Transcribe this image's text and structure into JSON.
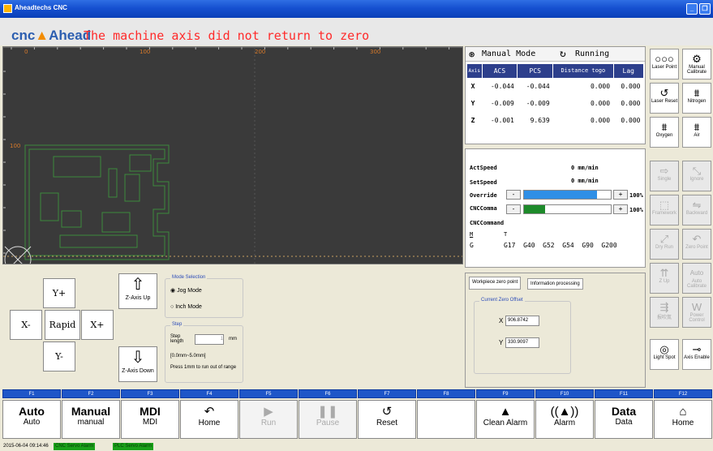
{
  "window": {
    "title": "Aheadtechs CNC"
  },
  "header": {
    "logo_main": "cnc",
    "logo_accent": "Ahead",
    "alarm_text": "The machine axis did not return to zero"
  },
  "canvas": {
    "ruler_labels": [
      "0",
      "100",
      "200",
      "300"
    ],
    "v_labels": [
      "100"
    ]
  },
  "status": {
    "mode_label": "Manual Mode",
    "run_label": "Running",
    "columns": [
      "Axis",
      "ACS",
      "PCS",
      "Distance togo",
      "Lag"
    ],
    "rows": [
      {
        "axis": "X",
        "acs": "-0.044",
        "pcs": "-0.044",
        "togo": "0.000",
        "lag": "0.000"
      },
      {
        "axis": "Y",
        "acs": "-0.009",
        "pcs": "-0.009",
        "togo": "0.000",
        "lag": "0.000"
      },
      {
        "axis": "Z",
        "acs": "-0.001",
        "pcs": "9.639",
        "togo": "0.000",
        "lag": "0.000"
      }
    ]
  },
  "speed": {
    "act_label": "ActSpeed",
    "act_value": "0 mm/min",
    "set_label": "SetSpeed",
    "set_value": "0 mm/min",
    "override_label": "Override",
    "override_pct": "100%",
    "override_level": 0.84,
    "cnccomma_label": "CNCComma",
    "cnccomma_pct": "100%",
    "cnccomma_level": 0.24,
    "command_label": "CNCCommand",
    "m_label": "M",
    "t_label": "T",
    "g_label": "G",
    "g_codes": "G17  G40  G52  G54  G90  G200"
  },
  "jog": {
    "y_plus": "Y+",
    "y_minus": "Y-",
    "x_minus": "X-",
    "x_plus": "X+",
    "rapid": "Rapid",
    "z_up": "Z-Axis Up",
    "z_down": "Z-Axis Down",
    "mode_title": "Mode Selection",
    "jog_mode": "Jog Mode",
    "inch_mode": "Inch Mode",
    "step_title": "Step",
    "step_length": "Step length",
    "step_value": "1",
    "step_unit": "mm",
    "step_range": "[0.0mm~5.0mm]",
    "step_hint": "Press 1mm to run out of range"
  },
  "workpiece": {
    "tab1": "Workpiece zero point",
    "tab2": "Information processing",
    "offset_title": "Current Zero Offset",
    "x_label": "X",
    "x_value": "906.8742",
    "y_label": "Y",
    "y_value": "330.9097"
  },
  "tools": [
    {
      "label": "Laser Point",
      "icon": "dots-icon",
      "glyph": "○○○",
      "disabled": false
    },
    {
      "label": "Manual Calibrate",
      "icon": "calibrate-icon",
      "glyph": "⚙",
      "disabled": false
    },
    {
      "label": "Laser Reset",
      "icon": "reset-icon",
      "glyph": "↺",
      "disabled": false
    },
    {
      "label": "Nitrogen",
      "icon": "gas-valve-icon",
      "glyph": "⩩",
      "disabled": false
    },
    {
      "label": "Oxygen",
      "icon": "gas-valve-icon",
      "glyph": "⩩",
      "disabled": false
    },
    {
      "label": "Air",
      "icon": "gas-valve-icon",
      "glyph": "⩩",
      "disabled": false
    },
    {
      "label": "Single",
      "icon": "arrow-right-icon",
      "glyph": "⇨",
      "disabled": true
    },
    {
      "label": "Ignore",
      "icon": "ignore-icon",
      "glyph": "⤡",
      "disabled": true
    },
    {
      "label": "Framework",
      "icon": "frame-icon",
      "glyph": "⬚",
      "disabled": true
    },
    {
      "label": "Backward",
      "icon": "backward-icon",
      "glyph": "⇋",
      "disabled": true
    },
    {
      "label": "Dry Run",
      "icon": "dry-run-icon",
      "glyph": "⤢",
      "disabled": true
    },
    {
      "label": "Zero Point",
      "icon": "zero-point-icon",
      "glyph": "↶",
      "disabled": true
    },
    {
      "label": "Z Up",
      "icon": "z-up-icon",
      "glyph": "⇈",
      "disabled": true
    },
    {
      "label": "Auto Calibrate",
      "icon": "auto-calibrate-icon",
      "glyph": "Auto",
      "disabled": true
    },
    {
      "label": "报吹氮",
      "icon": "blow-icon",
      "glyph": "⇶",
      "disabled": true
    },
    {
      "label": "Power Control",
      "icon": "power-control-icon",
      "glyph": "W",
      "disabled": true
    },
    {
      "label": "Light Spot",
      "icon": "light-spot-icon",
      "glyph": "◎",
      "disabled": false
    },
    {
      "label": "Axis Enable",
      "icon": "axis-enable-icon",
      "glyph": "⊸",
      "disabled": false
    }
  ],
  "fkeys": [
    {
      "key": "F1",
      "main": "Auto",
      "sub": "Auto",
      "type": "text",
      "disabled": false
    },
    {
      "key": "F2",
      "main": "Manual",
      "sub": "manual",
      "type": "text",
      "disabled": false
    },
    {
      "key": "F3",
      "main": "MDI",
      "sub": "MDI",
      "type": "text",
      "disabled": false
    },
    {
      "key": "F4",
      "main": "↶",
      "sub": "Home",
      "type": "icon",
      "icon": "return-icon",
      "disabled": false
    },
    {
      "key": "F5",
      "main": "▶",
      "sub": "Run",
      "type": "icon",
      "icon": "play-icon",
      "disabled": true
    },
    {
      "key": "F6",
      "main": "❚❚",
      "sub": "Pause",
      "type": "icon",
      "icon": "pause-icon",
      "disabled": true
    },
    {
      "key": "F7",
      "main": "↺",
      "sub": "Reset",
      "type": "icon",
      "icon": "reset-icon",
      "disabled": false
    },
    {
      "key": "F8",
      "main": "",
      "sub": "",
      "type": "icon",
      "icon": "empty-icon",
      "disabled": false
    },
    {
      "key": "F9",
      "main": "▲",
      "sub": "Clean Alarm",
      "type": "icon",
      "icon": "bell-icon",
      "disabled": false
    },
    {
      "key": "F10",
      "main": "((▲))",
      "sub": "Alarm",
      "type": "icon",
      "icon": "alarm-icon",
      "disabled": false
    },
    {
      "key": "F11",
      "main": "Data",
      "sub": "Data",
      "type": "text",
      "disabled": false
    },
    {
      "key": "F12",
      "main": "⌂",
      "sub": "Home",
      "type": "icon",
      "icon": "house-icon",
      "disabled": false
    }
  ],
  "statusbar": {
    "datetime": "2015-06-04 09:14:46",
    "servo1": "CNC Servo Alarm",
    "servo2": "PLC Servo Alarm"
  }
}
